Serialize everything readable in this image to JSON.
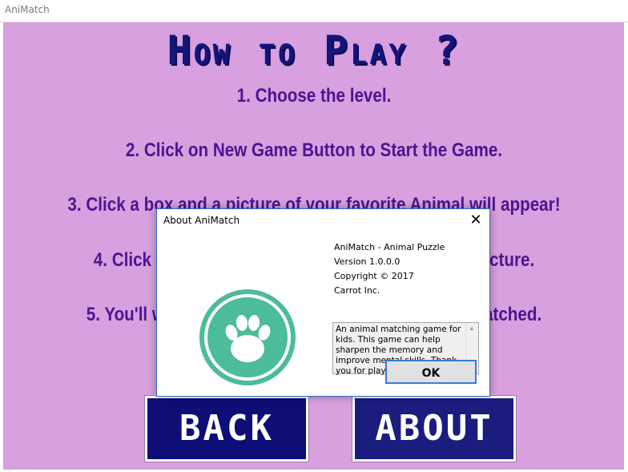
{
  "window": {
    "title": "AniMatch"
  },
  "main": {
    "heading": "How to Play ?",
    "steps": [
      "1.  Choose the level.",
      "2.  Click on New Game Button to Start the Game.",
      "3.  Click a box and a picture of your favorite Animal will appear!",
      "4.  Click another box to find the matching animal picture.",
      "5.  You'll win the game when all boxes have been matched."
    ],
    "back_label": "BACK",
    "about_label": "ABOUT"
  },
  "dialog": {
    "title": "About AniMatch",
    "close_glyph": "✕",
    "product": "AniMatch - Animal Puzzle",
    "version": "Version 1.0.0.0",
    "copyright": "Copyright ©  2017",
    "company": "Carrot Inc.",
    "description": "An animal matching game for kids. This game can help sharpen the memory and improve mental skills. Thank you for playing!",
    "ok_label": "OK",
    "logo_icon": "paw-print-icon",
    "logo_color": "#4cbc9a"
  },
  "colors": {
    "background": "#d8a0de",
    "heading": "#13157a",
    "steps": "#4d1491",
    "button_bg": "#0e0e77"
  }
}
